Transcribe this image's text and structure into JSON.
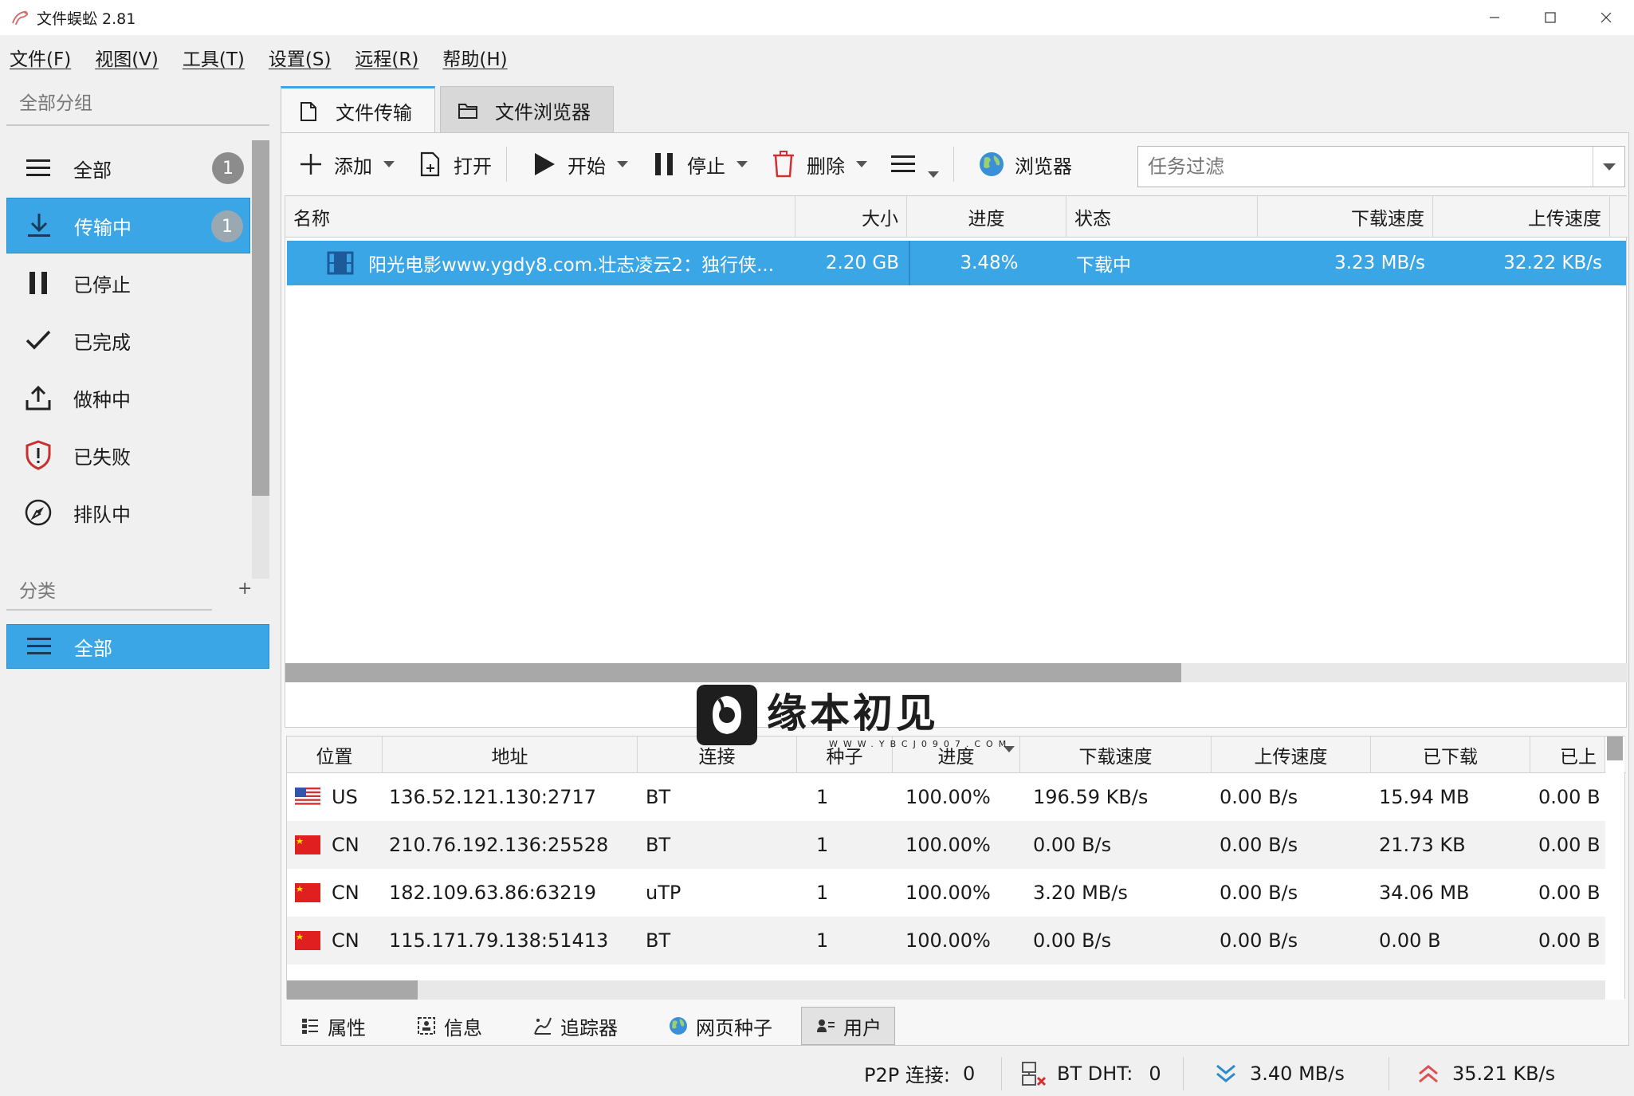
{
  "window": {
    "title": "文件蜈蚣 2.81"
  },
  "menu": [
    "文件(F)",
    "视图(V)",
    "工具(T)",
    "设置(S)",
    "远程(R)",
    "帮助(H)"
  ],
  "sidebar": {
    "group_header": "全部分组",
    "items": [
      {
        "label": "全部",
        "badge": "1",
        "icon": "list-icon"
      },
      {
        "label": "传输中",
        "badge": "1",
        "icon": "download-icon",
        "active": true
      },
      {
        "label": "已停止",
        "icon": "pause-icon"
      },
      {
        "label": "已完成",
        "icon": "check-icon"
      },
      {
        "label": "做种中",
        "icon": "upload-icon"
      },
      {
        "label": "已失败",
        "icon": "shield-alert-icon"
      },
      {
        "label": "排队中",
        "icon": "compass-icon"
      }
    ],
    "category_header": "分类",
    "category_add": "+",
    "category_item": "全部"
  },
  "tabs": [
    {
      "label": "文件传输",
      "active": true
    },
    {
      "label": "文件浏览器"
    }
  ],
  "toolbar": {
    "add": "添加",
    "open": "打开",
    "start": "开始",
    "stop": "停止",
    "delete": "删除",
    "browser": "浏览器",
    "filter_placeholder": "任务过滤"
  },
  "transfers": {
    "columns": [
      "名称",
      "大小",
      "进度",
      "状态",
      "下载速度",
      "上传速度"
    ],
    "rows": [
      {
        "name": "阳光电影www.ygdy8.com.壮志凌云2：独行侠...",
        "size": "2.20 GB",
        "progress": "3.48%",
        "status": "下载中",
        "down": "3.23 MB/s",
        "up": "32.22 KB/s"
      }
    ]
  },
  "watermark": {
    "text": "缘本初见",
    "subtext": "WWW.YBCJ0907.COM"
  },
  "peers": {
    "columns": [
      "位置",
      "地址",
      "连接",
      "种子",
      "进度",
      "下载速度",
      "上传速度",
      "已下载",
      "已上"
    ],
    "rows": [
      {
        "country": "US",
        "address": "136.52.121.130:2717",
        "conn": "BT",
        "seeds": "1",
        "progress": "100.00%",
        "down": "196.59 KB/s",
        "up": "0.00 B/s",
        "downloaded": "15.94 MB",
        "uploaded": "0.00 B"
      },
      {
        "country": "CN",
        "address": "210.76.192.136:25528",
        "conn": "BT",
        "seeds": "1",
        "progress": "100.00%",
        "down": "0.00 B/s",
        "up": "0.00 B/s",
        "downloaded": "21.73 KB",
        "uploaded": "0.00 B"
      },
      {
        "country": "CN",
        "address": "182.109.63.86:63219",
        "conn": "uTP",
        "seeds": "1",
        "progress": "100.00%",
        "down": "3.20 MB/s",
        "up": "0.00 B/s",
        "downloaded": "34.06 MB",
        "uploaded": "0.00 B"
      },
      {
        "country": "CN",
        "address": "115.171.79.138:51413",
        "conn": "BT",
        "seeds": "1",
        "progress": "100.00%",
        "down": "0.00 B/s",
        "up": "0.00 B/s",
        "downloaded": "0.00 B",
        "uploaded": "0.00 B"
      }
    ]
  },
  "bottom_tabs": [
    {
      "label": "属性"
    },
    {
      "label": "信息"
    },
    {
      "label": "追踪器"
    },
    {
      "label": "网页种子"
    },
    {
      "label": "用户",
      "active": true
    }
  ],
  "status": {
    "p2p_label": "P2P 连接:",
    "p2p_value": "0",
    "dht_label": "BT DHT:",
    "dht_value": "0",
    "down_speed": "3.40 MB/s",
    "up_speed": "35.21 KB/s"
  },
  "colors": {
    "accent": "#3ba6e6",
    "down_arrow": "#2a8ccc",
    "up_arrow": "#e05050"
  }
}
